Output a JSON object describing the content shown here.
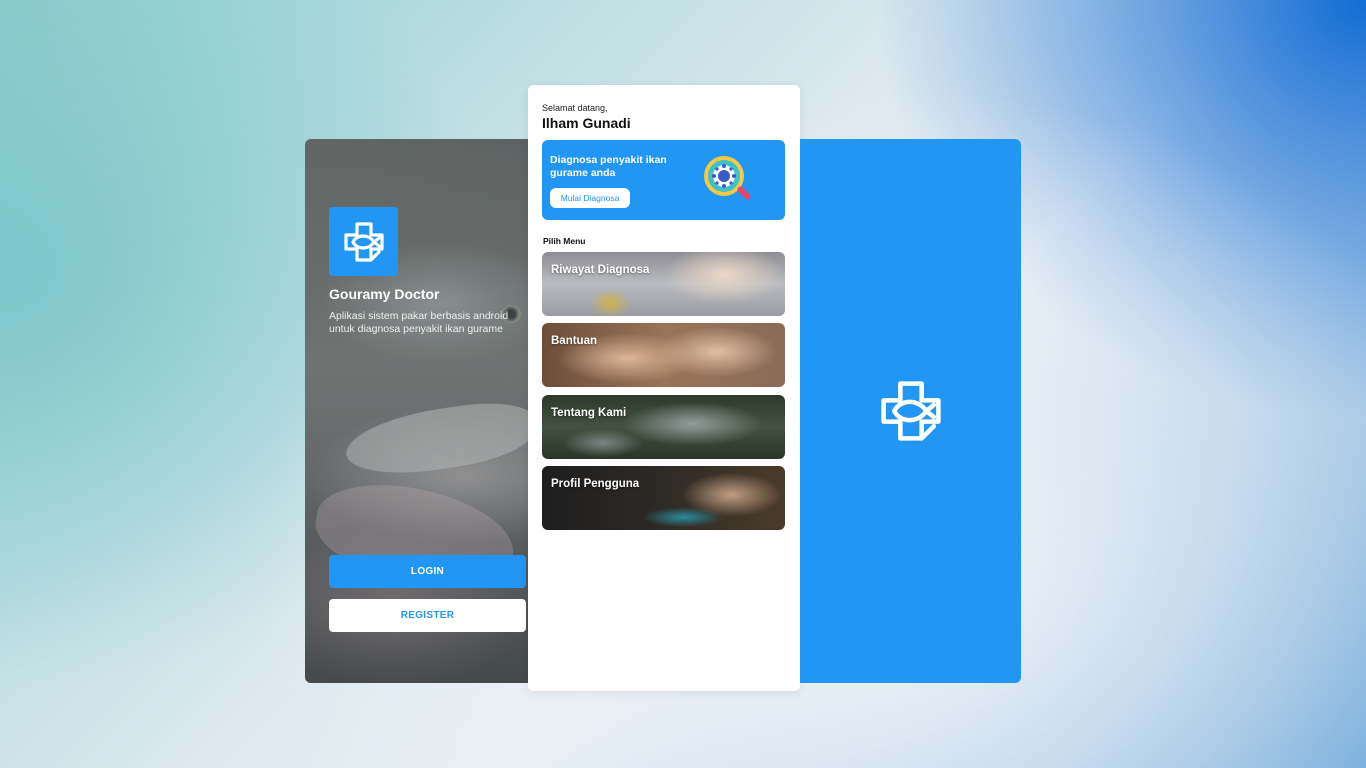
{
  "login_screen": {
    "app_name": "Gouramy Doctor",
    "description": "Aplikasi sistem pakar berbasis android untuk diagnosa penyakit ikan gurame",
    "login_label": "LOGIN",
    "register_label": "REGISTER",
    "logo_icon": "medical-cross-fish-icon"
  },
  "home_screen": {
    "greeting": "Selamat datang,",
    "user_name": "Ilham Gunadi",
    "banner": {
      "text": "Diagnosa penyakit ikan gurame anda",
      "button_label": "Mulai Diagnosa",
      "illustration_icon": "magnifier-virus-icon"
    },
    "menu_heading": "Pilih Menu",
    "menu_items": [
      {
        "label": "Riwayat Diagnosa"
      },
      {
        "label": "Bantuan"
      },
      {
        "label": "Tentang Kami"
      },
      {
        "label": "Profil Pengguna"
      }
    ]
  },
  "splash_screen": {
    "logo_icon": "medical-cross-fish-icon"
  },
  "colors": {
    "primary": "#2196f3",
    "white": "#ffffff",
    "text_dark": "#111111"
  }
}
